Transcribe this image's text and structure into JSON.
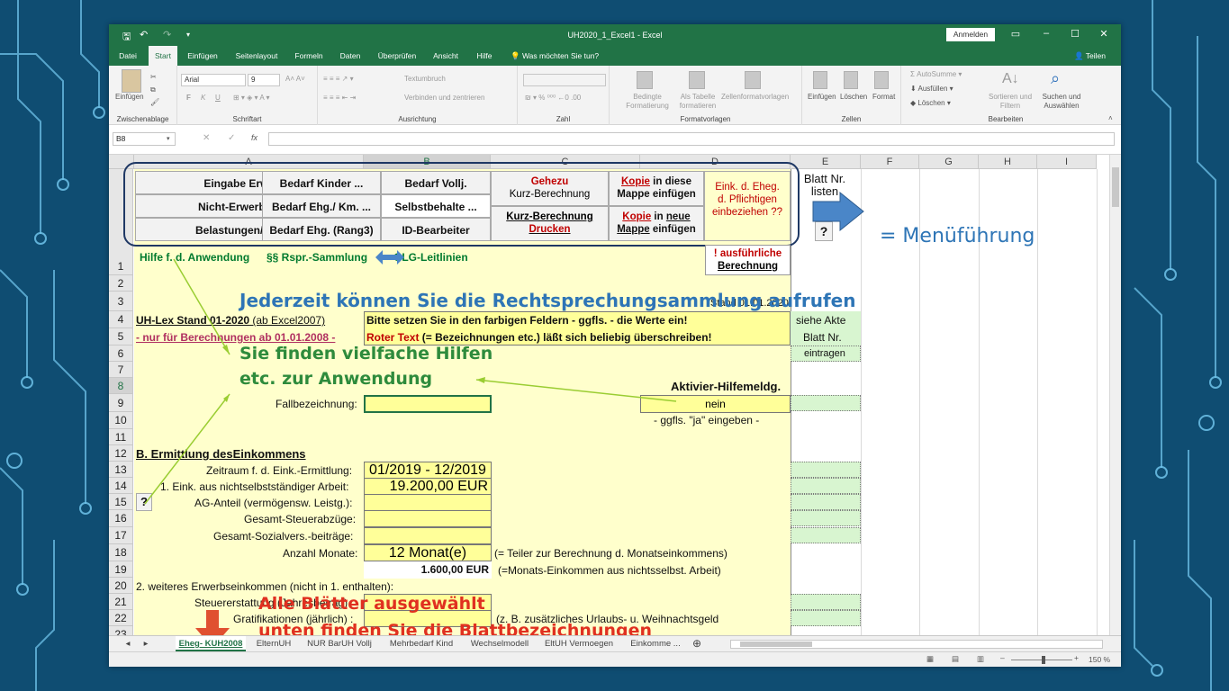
{
  "window": {
    "title": "UH2020_1_Excel1  -  Excel",
    "signin": "Anmelden",
    "share": "Teilen",
    "tell_me": "Was möchten Sie tun?"
  },
  "tabs": [
    "Datei",
    "Start",
    "Einfügen",
    "Seitenlayout",
    "Formeln",
    "Daten",
    "Überprüfen",
    "Ansicht",
    "Hilfe"
  ],
  "ribbon": {
    "clipboard": {
      "label": "Zwischenablage",
      "paste": "Einfügen"
    },
    "font": {
      "label": "Schriftart",
      "name": "Arial",
      "size": "9",
      "bold": "F",
      "italic": "K",
      "underline": "U"
    },
    "alignment": {
      "label": "Ausrichtung",
      "wrap": "Textumbruch",
      "merge": "Verbinden und zentrieren"
    },
    "number": {
      "label": "Zahl"
    },
    "styles": {
      "label": "Formatvorlagen",
      "conditional": "Bedingte Formatierung",
      "table": "Als Tabelle formatieren",
      "cellstyles": "Zellenformatvorlagen"
    },
    "cells": {
      "label": "Zellen",
      "insert": "Einfügen",
      "delete": "Löschen",
      "format": "Format"
    },
    "editing": {
      "label": "Bearbeiten",
      "autosum": "AutoSumme",
      "fill": "Ausfüllen",
      "clear": "Löschen",
      "sort": "Sortieren und Filtern",
      "find": "Suchen und Auswählen"
    }
  },
  "formula_bar": {
    "namebox": "B8",
    "fx": "fx"
  },
  "columns": [
    "A",
    "B",
    "C",
    "D",
    "E",
    "F",
    "G",
    "H",
    "I"
  ],
  "rows": [
    "1",
    "2",
    "3",
    "4",
    "5",
    "6",
    "7",
    "8",
    "9",
    "10",
    "11",
    "12",
    "13",
    "14",
    "15",
    "16",
    "17",
    "18",
    "19",
    "20",
    "21",
    "22",
    "23"
  ],
  "menu": {
    "a1": "Eingabe Erwerbs-",
    "a2": "Nicht-Erwerbs-Eink.",
    "a3": "Belastungen/ Kredite",
    "b1": "Bedarf Kinder ...",
    "b2": "Bedarf  Ehg./ Km. ...",
    "b3": "Bedarf Ehg. (Rang3)",
    "c1": "Bedarf Vollj.",
    "c2": "Selbstbehalte ...",
    "c3": "ID-Bearbeiter",
    "d1a": "Gehezu",
    "d1b": "Kurz-Berechnung",
    "d3a": "Kurz-Berechnung",
    "d3b": "Drucken",
    "e1a": "Kopie",
    "e1b": " in diese",
    "e1c": "Mappe einfügen",
    "e3a": "Kopie",
    "e3b": "  in ",
    "e3c": "neue",
    "e3d": "Mappe",
    "e3e": " einfügen",
    "f1": "Eink. d. Eheg.",
    "f2": "d. Pflichtigen",
    "f3": "einbeziehen ??",
    "g1": "Blatt Nr.",
    "g2": "listen",
    "q": "?"
  },
  "row1": {
    "hilfe": "Hilfe f. d. Anwendung",
    "ss": "§§  Rspr.-Sammlung",
    "olg": "OLG-Leitlinien",
    "ausf": "! ausführliche",
    "ber": "Berechnung"
  },
  "cells": {
    "stand": "Stand 01.01.2020",
    "r3a": "UH-Lex Stand 01-2020",
    "r3b": " (ab Excel2007)",
    "r3c": "Bitte setzen Sie in den farbigen Feldern - ggfls. - die Werte ein!",
    "r3e": "siehe Akte",
    "r4a": "- nur für Berechnungen ab 01.01.2008 -",
    "r4c1": "Roter Text",
    "r4c2": " (= Bezeichnungen etc.) läßt sich beliebig überschreiben!",
    "r4e": "Blatt Nr.",
    "r5e": "eintragen",
    "r7d": "Aktivier-Hilfemeldg.",
    "r8a": "Fallbezeichnung:",
    "r8d": "nein",
    "r9d": "- ggfls. \"ja\" eingeben -",
    "r11a": "B. Ermittlung desEinkommens",
    "r12a": "Zeitraum f. d. Eink.-Ermittlung:",
    "r12b": "01/2019 - 12/2019",
    "r13a": "1. Eink. aus nichtselbstständiger Arbeit:",
    "r13b": "19.200,00 EUR",
    "r14a": "AG-Anteil (vermögensw. Leistg.):",
    "r14q": "?",
    "r15a": "Gesamt-Steuerabzüge:",
    "r16a": "Gesamt-Sozialvers.-beiträge:",
    "r17a": "Anzahl Monate:",
    "r17b": "12 Monat(e)",
    "r17c": "(= Teiler zur Berechnung d. Monatseinkommens)",
    "r18b": "1.600,00 EUR",
    "r18c": "(=Monats-Einkommen aus nichtsselbst. Arbeit)",
    "r19a": "2. weiteres Erwerbseinkommen (nicht in 1. enthalten):",
    "r20a": "Steuererstattung (Jahresbetrag)",
    "r21a": "Gratifikationen (jährlich) :",
    "r21c": "(z. B. zusätzliches Urlaubs- u. Weihnachtsgeld"
  },
  "annotations": {
    "menu": "= Menüführung",
    "rspr": "Jederzeit können Sie die Rechtsprechungsammlung aufrufen",
    "hilfe1": "Sie finden vielfache Hilfen",
    "hilfe2": "etc. zur Anwendung",
    "blatt1": "Alle Blätter ausgewählt",
    "blatt2": "unten finden Sie die Blattbezeichnungen"
  },
  "sheet_tabs": [
    "Eheg- KUH2008",
    "ElternUH",
    "NUR BarUH Vollj",
    "Mehrbedarf Kind",
    "Wechselmodell",
    "EltUH Vermoegen",
    "Einkomme ..."
  ],
  "status": {
    "zoom": "150 %"
  },
  "colors": {
    "excel_green": "#217346",
    "sheet_yellow": "#ffffcc",
    "input_yellow": "#ffff99",
    "annotation_blue": "#2e75b6",
    "annotation_green": "#2e8b3c",
    "annotation_red": "#e03020"
  }
}
